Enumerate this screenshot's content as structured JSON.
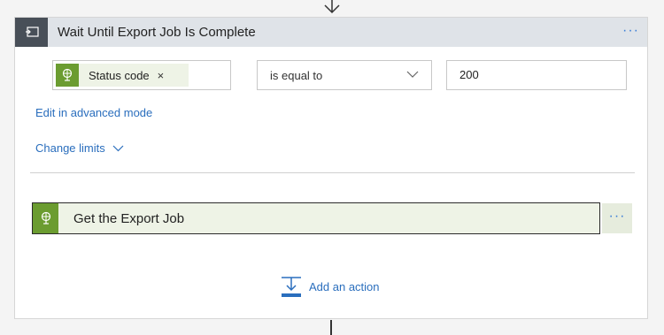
{
  "scope": {
    "title": "Wait Until Export Job Is Complete",
    "more_label": "···"
  },
  "condition": {
    "left_token": "Status code",
    "left_token_remove": "×",
    "operator": "is equal to",
    "right_value": "200"
  },
  "links": {
    "advanced_mode": "Edit in advanced mode",
    "change_limits": "Change limits"
  },
  "inner_action": {
    "title": "Get the Export Job",
    "more_label": "···"
  },
  "add_action": {
    "label": "Add an action"
  },
  "colors": {
    "header_bg": "#dfe3e8",
    "header_icon_bg": "#484f58",
    "api_green": "#6b9c30",
    "token_bg": "#eef3e6",
    "link_blue": "#2a6ebd"
  },
  "icons": {
    "header": "until-loop-icon",
    "token": "api-globe-icon",
    "action": "api-globe-icon",
    "add_action": "add-action-icon"
  }
}
